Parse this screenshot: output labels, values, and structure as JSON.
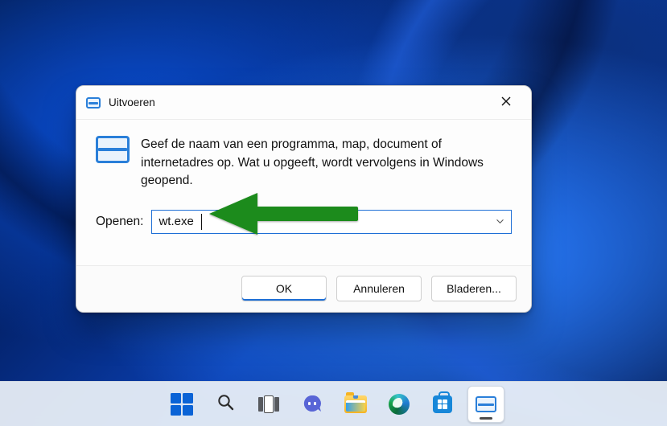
{
  "dialog": {
    "title": "Uitvoeren",
    "description": "Geef de naam van een programma, map, document of internetadres op. Wat u opgeeft, wordt vervolgens in Windows geopend.",
    "open_label": "Openen:",
    "input_value": "wt.exe",
    "buttons": {
      "ok": "OK",
      "cancel": "Annuleren",
      "browse": "Bladeren..."
    }
  },
  "annotations": {
    "arrow_color": "#1f8b1f"
  },
  "taskbar": {
    "items": [
      {
        "name": "start",
        "label": "Start"
      },
      {
        "name": "search",
        "label": "Search"
      },
      {
        "name": "task-view",
        "label": "Task View"
      },
      {
        "name": "chat",
        "label": "Chat"
      },
      {
        "name": "file-explorer",
        "label": "File Explorer"
      },
      {
        "name": "edge",
        "label": "Microsoft Edge"
      },
      {
        "name": "store",
        "label": "Microsoft Store"
      },
      {
        "name": "run",
        "label": "Run",
        "active": true
      }
    ]
  }
}
